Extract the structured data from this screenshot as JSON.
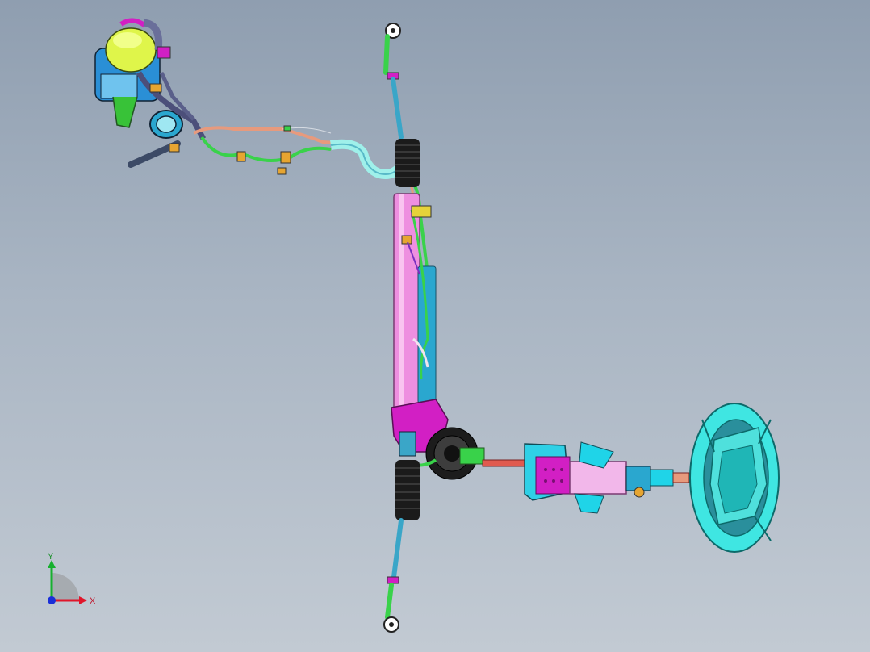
{
  "triad": {
    "x_label": "X",
    "y_label": "Y"
  },
  "colors": {
    "rack_housing": "#ee8fe0",
    "boot": "#1b1b1b",
    "tie_rod": "#3aa6c8",
    "wheel": "#3fe6e2",
    "reservoir": "#dff54a",
    "hose_green": "#39d24a",
    "pipe_salmon": "#e79a7d",
    "magenta": "#d21fc4",
    "column": "#f2b7ea",
    "cyan": "#1fd4e8"
  }
}
